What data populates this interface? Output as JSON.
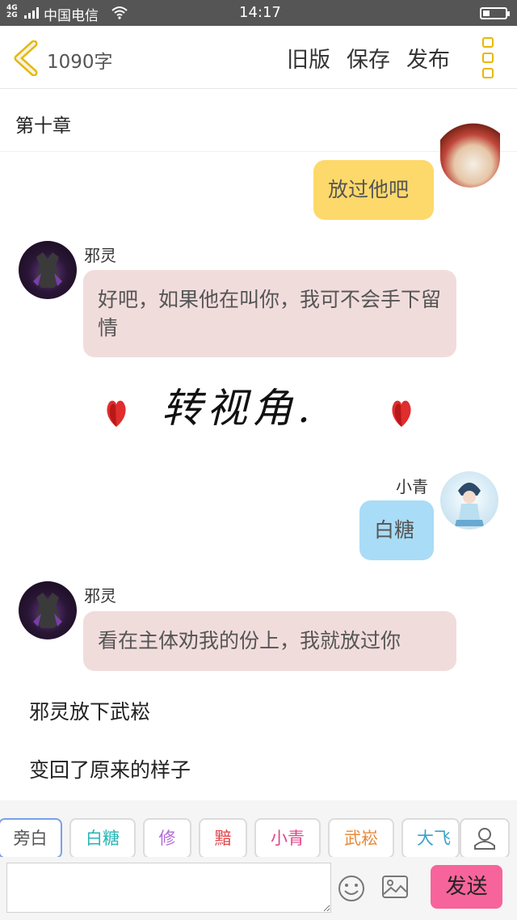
{
  "status_bar": {
    "network": "4G\n2G",
    "carrier": "中国电信",
    "time": "14:17",
    "battery_level": 0.3
  },
  "header": {
    "word_count": "1090字",
    "buttons": {
      "old": "旧版",
      "save": "保存",
      "publish": "发布"
    },
    "icons": {
      "back": "chevron-left-icon",
      "menu": "more-vertical-icon"
    },
    "accent_color": "#e6b800"
  },
  "chapter": {
    "title": "第十章"
  },
  "chat": {
    "m1": {
      "text": "放过他吧",
      "color": "#fdd96b"
    },
    "m2": {
      "speaker": "邪灵",
      "text": "好吧，如果他在叫你，我可不会手下留情",
      "color": "#f1dcdc"
    },
    "scene_break": "转视角.",
    "m3": {
      "speaker": "小青",
      "text": "白糖",
      "color": "#a9dcf6"
    },
    "m4": {
      "speaker": "邪灵",
      "text": "看在主体劝我的份上，我就放过你",
      "color": "#f1dcdc"
    }
  },
  "narration": {
    "n1": "邪灵放下武崧",
    "n2": "变回了原来的样子"
  },
  "roles": [
    {
      "label": "旁白",
      "color": "#555555"
    },
    {
      "label": "白糖",
      "color": "#28b5b5"
    },
    {
      "label": "修",
      "color": "#b06ad8"
    },
    {
      "label": "黯",
      "color": "#e0454b"
    },
    {
      "label": "小青",
      "color": "#e2478c"
    },
    {
      "label": "武崧",
      "color": "#e88a3a"
    },
    {
      "label": "大飞",
      "color": "#36a3c8"
    }
  ],
  "composer": {
    "placeholder": "",
    "send_label": "发送",
    "send_color": "#f6649b",
    "icons": {
      "emoji": "emoji-icon",
      "image": "image-icon",
      "role": "person-icon"
    }
  }
}
